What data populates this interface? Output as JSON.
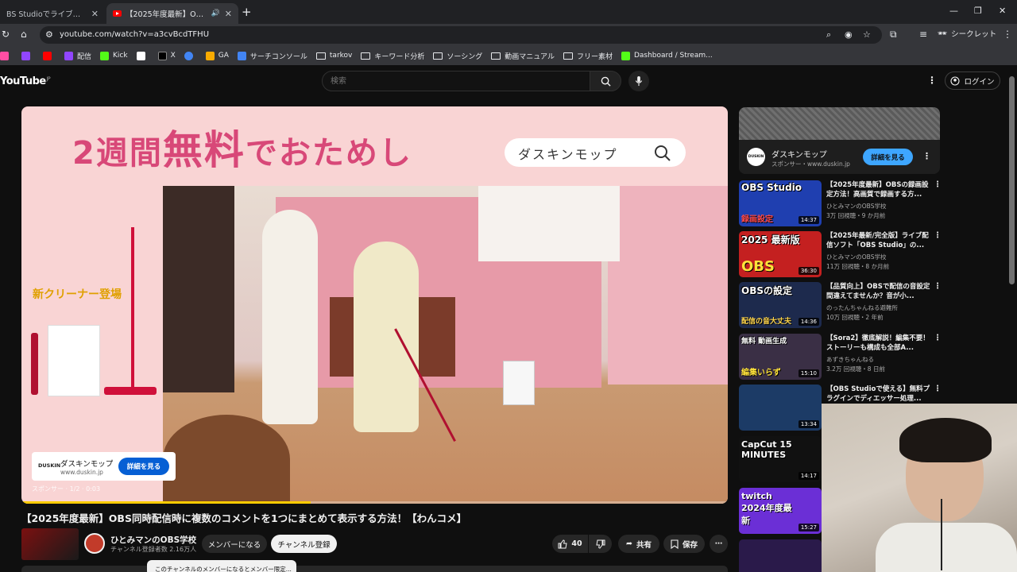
{
  "browser": {
    "tabs": [
      {
        "title": "BS Studioでライブ視聴者数を確",
        "close": "✕"
      },
      {
        "title": "【2025年度最新】OBS同時配",
        "speaker": "🔊",
        "close": "✕"
      }
    ],
    "new_tab": "+",
    "window_controls": {
      "minimize": "—",
      "restore": "❐",
      "close": "✕"
    },
    "url": "youtube.com/watch?v=a3cvBcdTFHU",
    "profile_label": "シークレット",
    "bookmarks": [
      {
        "label": "",
        "color": "#ff4ea3"
      },
      {
        "label": "",
        "color": "#9146ff"
      },
      {
        "label": "",
        "color": "#ff0000"
      },
      {
        "label": "配信",
        "color": "#9146ff"
      },
      {
        "label": "Kick",
        "color": "#53fc18"
      },
      {
        "label": "",
        "color": "#ffffff"
      },
      {
        "label": "X",
        "color": "#000000"
      },
      {
        "label": "",
        "color": "#4285f4"
      },
      {
        "label": "GA",
        "color": "#f9ab00"
      },
      {
        "label": "サーチコンソール",
        "color": "#4285f4"
      }
    ],
    "bookmark_folders": [
      "tarkov",
      "キーワード分析",
      "ソーシング",
      "動画マニュアル",
      "フリー素材"
    ],
    "bookmark_last": "Dashboard / Stream..."
  },
  "youtube": {
    "logo": "YouTube",
    "logo_region": "JP",
    "search_placeholder": "検索",
    "login_label": "ログイン"
  },
  "ad": {
    "headline_pre": "2週間",
    "headline_big": "無料",
    "headline_post": "でおためし",
    "search_text": "ダスキンモップ",
    "new_cleaner": "新クリーナー登場",
    "card_logo": "DUSKIN",
    "card_name": "ダスキンモップ",
    "card_domain": "www.duskin.jp",
    "card_button": "詳細を見る",
    "sponsor_line": "スポンサー · 1/2 · 0:03",
    "progress": 0.41,
    "colors": {
      "headline": "#d84878",
      "button": "#065fd4"
    }
  },
  "video": {
    "title": "【2025年度最新】OBS同時配信時に複数のコメントを1つにまとめて表示する方法！【わんコメ】",
    "channel": "ひとみマンのOBS学校",
    "subscribers": "チャンネル登録者数 2.16万人",
    "member_button": "メンバーになる",
    "subscribe_button": "チャンネル登録",
    "likes": "40",
    "share": "共有",
    "save": "保存",
    "tooltip": "このチャンネルのメンバーになるとメンバー限定..."
  },
  "sidebar_ad": {
    "logo": "DUSKIN",
    "name": "ダスキンモップ",
    "sponsor": "スポンサー・www.duskin.jp",
    "button": "詳細を見る"
  },
  "recommendations": [
    {
      "title": "【2025年度最新】OBSの録画設定方法！高画質で録画する方...",
      "channel": "ひとみマンのOBS学校",
      "meta": "3万 回視聴・9 か月前",
      "duration": "14:37",
      "thumb_top": "OBS Studio",
      "thumb_bottom": "録画設定",
      "thumb_bg": "#1f3fb0"
    },
    {
      "title": "【2025年最新/完全版】ライブ配信ソフト「OBS Studio」の...",
      "channel": "ひとみマンのOBS学校",
      "meta": "11万 回視聴・8 か月前",
      "duration": "36:30",
      "thumb_top": "2025 最新版",
      "thumb_bottom": "OBS",
      "thumb_bg": "#c42020"
    },
    {
      "title": "【品質向上】OBSで配信の音設定間違えてませんか？音が小...",
      "channel": "のったんちゃんねる避難所",
      "meta": "10万 回視聴・2 年前",
      "duration": "14:36",
      "thumb_top": "OBSの設定",
      "thumb_bottom": "配信の音大丈夫",
      "thumb_bg": "#1d2a4d"
    },
    {
      "title": "【Sora2】徹底解説！編集不要！ストーリーも構成も全部A...",
      "channel": "あずきちゃんねる",
      "meta": "3.2万 回視聴・8 日前",
      "duration": "15:10",
      "thumb_top": "無料 動画生成",
      "thumb_bottom": "編集いらず",
      "thumb_bg": "#3a2f45"
    },
    {
      "title": "【OBS Studioで使える】無料プラグインでディエッサー処理...",
      "channel": "",
      "meta": "",
      "duration": "13:34",
      "thumb_top": "",
      "thumb_bottom": "",
      "thumb_bg": "#1c3b66"
    }
  ],
  "more_thumbs": [
    {
      "text": "CapCut 15 MINUTES",
      "duration": "14:17",
      "bg": "#111111"
    },
    {
      "text": "twitch 2024年度最新",
      "duration": "15:27",
      "bg": "#6b2fd6"
    },
    {
      "text": "",
      "duration": "",
      "bg": "#2a1a4a"
    }
  ]
}
